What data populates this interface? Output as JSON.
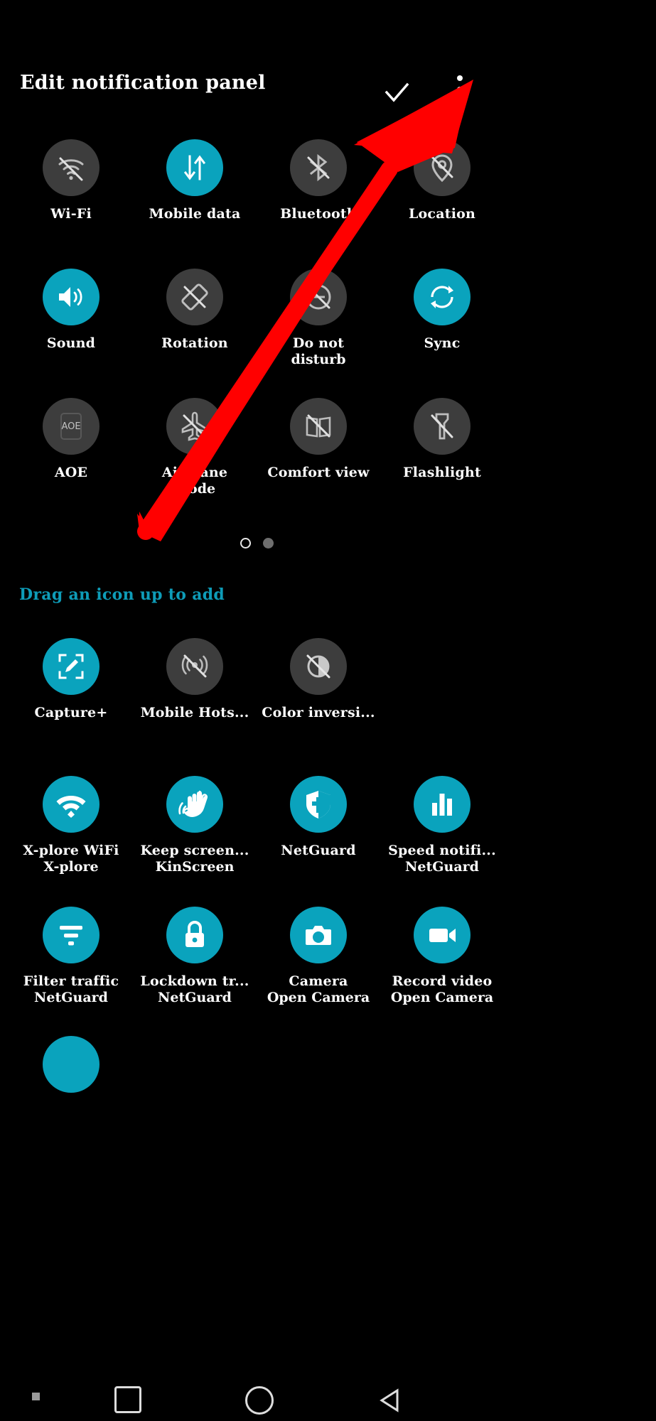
{
  "screen": {
    "background_color": "#000000",
    "accent_color": "#0aa3bd",
    "inactive_color": "#3d3d3d",
    "hint_color": "#0e9cb8"
  },
  "header": {
    "title": "Edit notification panel",
    "confirm_icon": "check-icon",
    "overflow_icon": "more-vertical-icon"
  },
  "active_panel": {
    "tiles": [
      {
        "label": "Wi-Fi",
        "label2": "",
        "state": "off",
        "icon": "wifi-off-icon"
      },
      {
        "label": "Mobile data",
        "label2": "",
        "state": "on",
        "icon": "mobile-data-icon"
      },
      {
        "label": "Bluetooth",
        "label2": "",
        "state": "off",
        "icon": "bluetooth-off-icon"
      },
      {
        "label": "Location",
        "label2": "",
        "state": "off",
        "icon": "location-off-icon"
      },
      {
        "label": "Sound",
        "label2": "",
        "state": "on",
        "icon": "volume-up-icon"
      },
      {
        "label": "Rotation",
        "label2": "",
        "state": "off",
        "icon": "rotation-lock-icon"
      },
      {
        "label": "Do not",
        "label2": "disturb",
        "state": "off",
        "icon": "do-not-disturb-icon"
      },
      {
        "label": "Sync",
        "label2": "",
        "state": "on",
        "icon": "sync-icon"
      },
      {
        "label": "AOE",
        "label2": "",
        "state": "off",
        "icon": "aoe-icon"
      },
      {
        "label": "Airplane",
        "label2": "mode",
        "state": "off",
        "icon": "airplane-off-icon"
      },
      {
        "label": "Comfort view",
        "label2": "",
        "state": "off",
        "icon": "comfort-view-icon"
      },
      {
        "label": "Flashlight",
        "label2": "",
        "state": "off",
        "icon": "flashlight-off-icon"
      }
    ],
    "pager": {
      "pages": 2,
      "current": 2,
      "dots": [
        "hollow",
        "filled"
      ]
    }
  },
  "available_section": {
    "hint": "Drag an icon up to add",
    "tiles": [
      {
        "label": "Capture+",
        "label2": "",
        "state": "on",
        "icon": "capture-plus-icon"
      },
      {
        "label": "Mobile Hots...",
        "label2": "",
        "state": "off",
        "icon": "hotspot-off-icon"
      },
      {
        "label": "Color inversi...",
        "label2": "",
        "state": "off",
        "icon": "color-inversion-icon"
      },
      {
        "label": "X-plore WiFi",
        "label2": "X-plore",
        "state": "on",
        "icon": "wifi-icon"
      },
      {
        "label": "Keep screen...",
        "label2": "KinScreen",
        "state": "on",
        "icon": "hand-wave-icon"
      },
      {
        "label": "NetGuard",
        "label2": "",
        "state": "on",
        "icon": "shield-icon"
      },
      {
        "label": "Speed notifi...",
        "label2": "NetGuard",
        "state": "on",
        "icon": "bar-chart-icon"
      },
      {
        "label": "Filter traffic",
        "label2": "NetGuard",
        "state": "on",
        "icon": "filter-icon"
      },
      {
        "label": "Lockdown tr...",
        "label2": "NetGuard",
        "state": "on",
        "icon": "lock-icon"
      },
      {
        "label": "Camera",
        "label2": "Open Camera",
        "state": "on",
        "icon": "camera-icon"
      },
      {
        "label": "Record video",
        "label2": "Open Camera",
        "state": "on",
        "icon": "video-camera-icon"
      }
    ]
  },
  "navbar": {
    "items": [
      {
        "name": "recents-dot",
        "icon": "square-dot-icon"
      },
      {
        "name": "overview",
        "icon": "square-icon"
      },
      {
        "name": "home",
        "icon": "circle-icon"
      },
      {
        "name": "back",
        "icon": "triangle-back-icon"
      }
    ]
  },
  "annotation": {
    "type": "arrow",
    "color": "#ff0000",
    "points_to": "overflow-menu-button"
  }
}
